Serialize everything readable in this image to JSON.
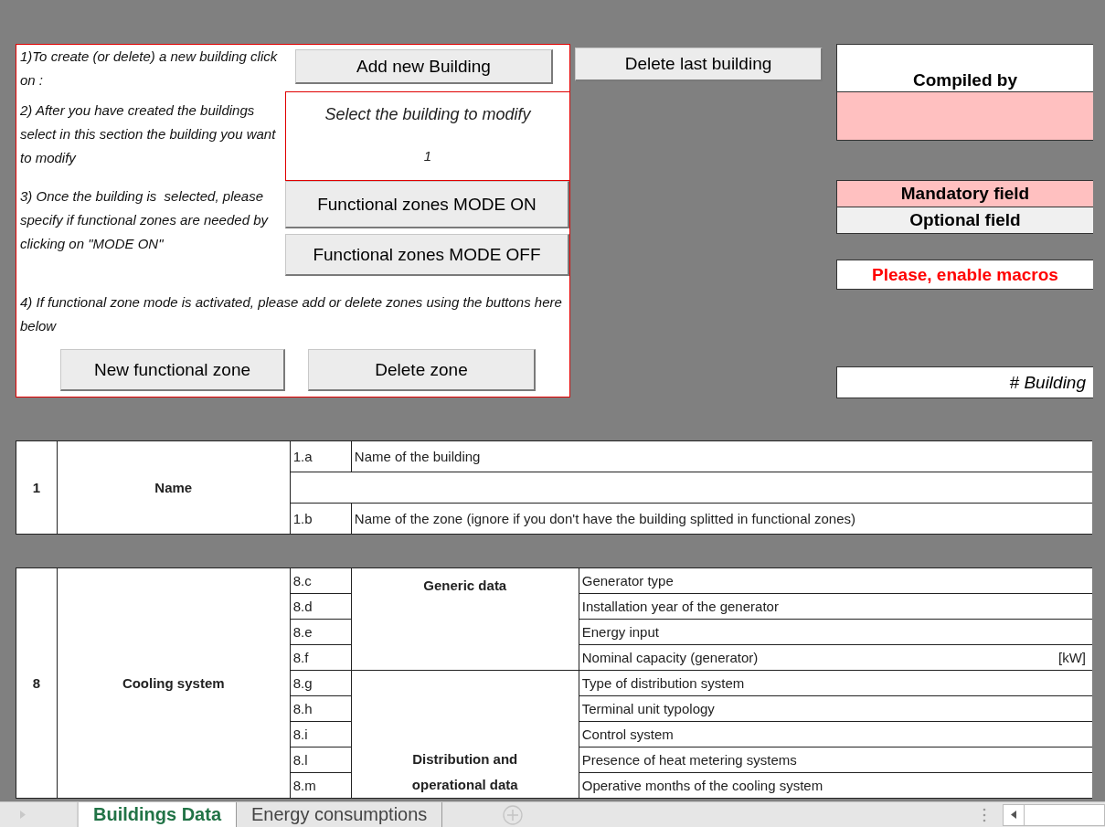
{
  "instructions": [
    {
      "text": "1)To create (or delete) a new building click on :"
    },
    {
      "text": "2) After you have created the buildings select in this section the building you want to modify"
    },
    {
      "text": "3) Once the building is  selected, please specify if functional zones are needed by clicking on \"MODE ON\""
    },
    {
      "text": "4) If functional zone mode is activated, please add or delete zones using the buttons here below"
    }
  ],
  "buttons": {
    "add_building": "Add new Building",
    "delete_building": "Delete last building",
    "mode_on": "Functional zones MODE ON",
    "mode_off": "Functional zones MODE OFF",
    "new_zone": "New functional zone",
    "delete_zone": "Delete zone"
  },
  "building_selector": {
    "label": "Select the building to modify",
    "value": "1"
  },
  "compiled_by": {
    "label": "Compiled by",
    "required": true
  },
  "legend": [
    {
      "label": "Mandatory field",
      "color": "#ffc0c0"
    },
    {
      "label": "Optional field",
      "color": "#f0f0f0"
    }
  ],
  "macro_warning": "Please, enable macros",
  "building_number_label": "# Building",
  "sections": [
    {
      "number": "1",
      "name": "Name",
      "rows": [
        {
          "kind": "item",
          "code": "1.a",
          "label": "Name of the building"
        },
        {
          "kind": "blank"
        },
        {
          "kind": "item",
          "code": "1.b",
          "label": "Name of the zone (ignore if you don't have the building splitted in functional zones)"
        }
      ]
    },
    {
      "number": "8",
      "name": "Cooling system",
      "groups": [
        {
          "title": "Generic data",
          "rows": [
            {
              "code": "8.c",
              "label": "Generator type"
            },
            {
              "code": "8.d",
              "label": "Installation year of the generator"
            },
            {
              "code": "8.e",
              "label": "Energy input"
            },
            {
              "code": "8.f",
              "label": "Nominal capacity (generator)",
              "unit": "[kW]"
            }
          ]
        },
        {
          "title": "Distribution and operational data",
          "rows": [
            {
              "code": "8.g",
              "label": "Type of distribution system"
            },
            {
              "code": "8.h",
              "label": "Terminal unit typology"
            },
            {
              "code": "8.i",
              "label": "Control system"
            },
            {
              "code": "8.l",
              "label": "Presence of heat metering systems"
            },
            {
              "code": "8.m",
              "label": "Operative months of  the cooling system"
            }
          ]
        }
      ]
    }
  ],
  "tabs": [
    {
      "label": "Buildings Data",
      "selected": true
    },
    {
      "label": "Energy consumptions",
      "selected": false
    }
  ]
}
